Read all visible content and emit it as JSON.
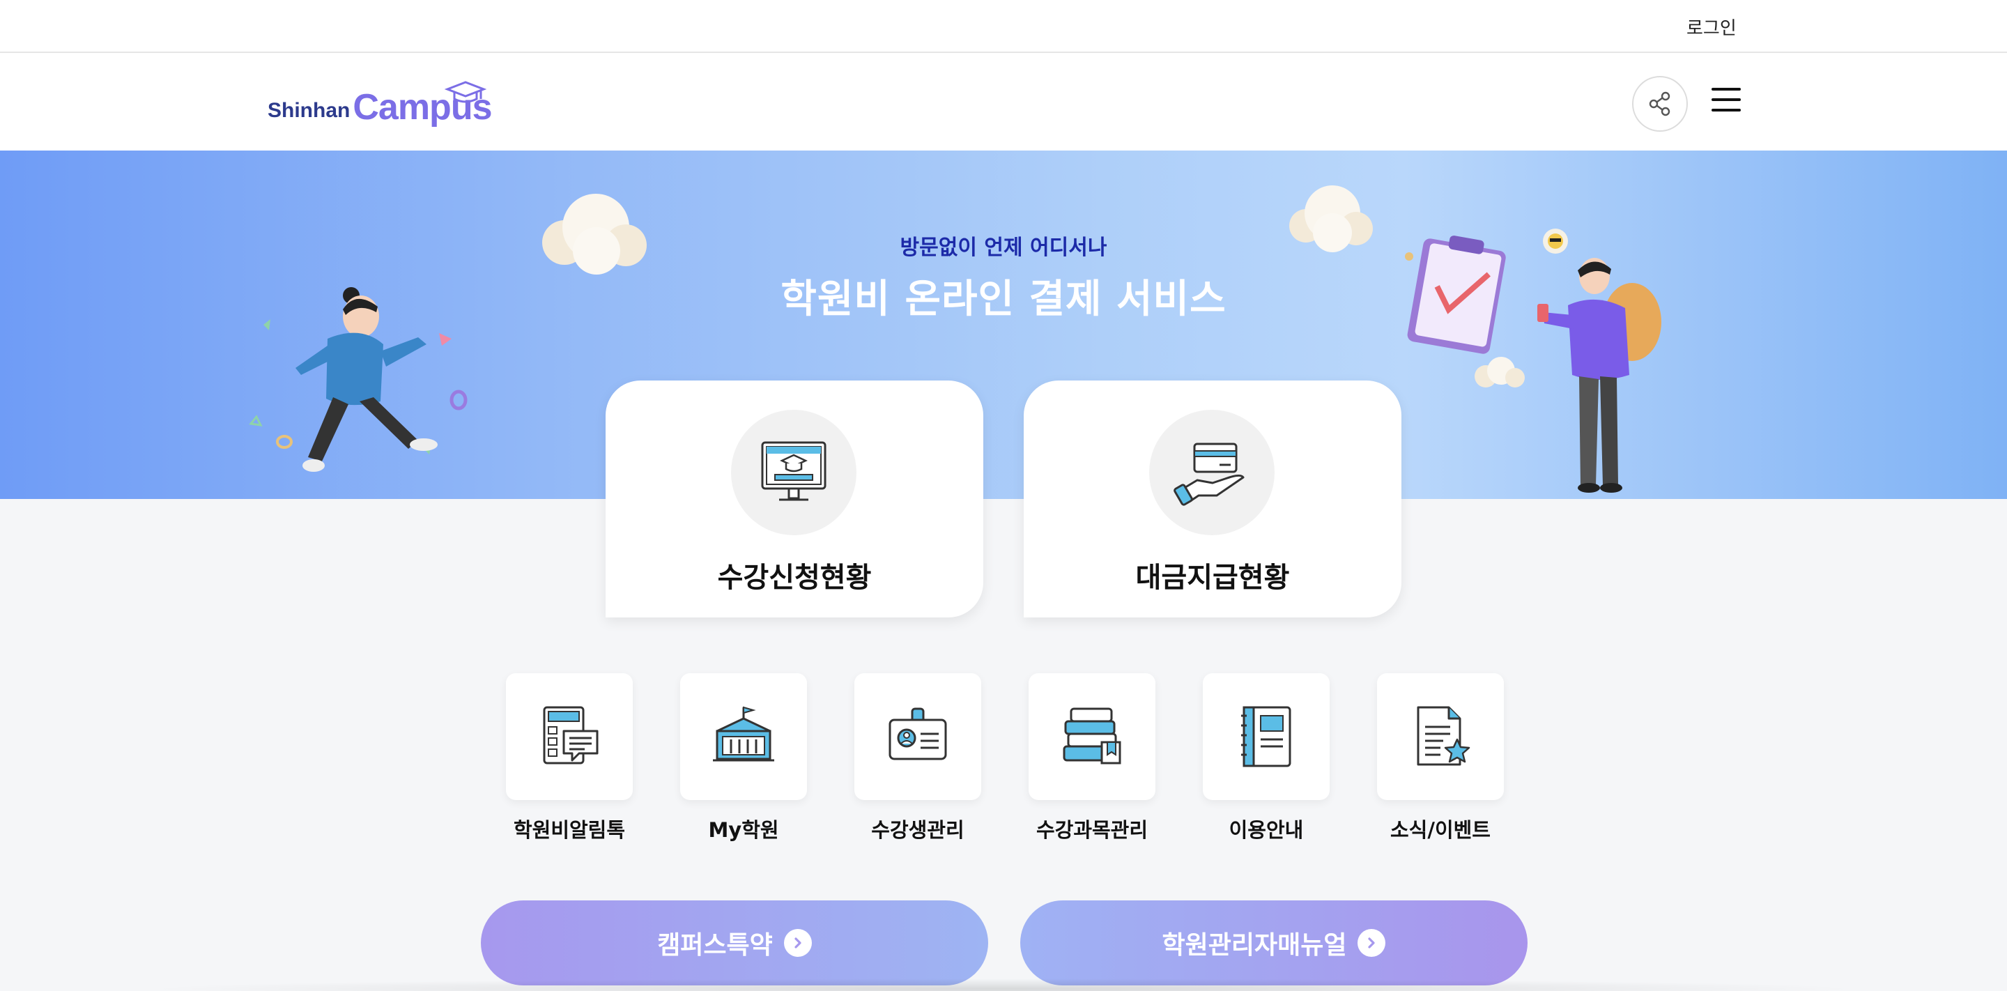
{
  "topbar": {
    "login_label": "로그인"
  },
  "header": {
    "logo_shinhan": "Shinhan",
    "logo_campus": "Campus",
    "share_icon": "share-icon",
    "menu_icon": "hamburger-menu-icon"
  },
  "banner": {
    "subtitle": "방문없이 언제 어디서나",
    "title": "학원비 온라인 결제 서비스"
  },
  "main_cards": [
    {
      "label": "수강신청현황",
      "icon": "monitor-graduation-cap-icon"
    },
    {
      "label": "대금지급현황",
      "icon": "hand-card-icon"
    }
  ],
  "quick_menu": [
    {
      "label": "학원비알림톡",
      "icon": "calculator-message-icon"
    },
    {
      "label": "My학원",
      "icon": "school-building-icon"
    },
    {
      "label": "수강생관리",
      "icon": "id-card-icon"
    },
    {
      "label": "수강과목관리",
      "icon": "book-stack-icon"
    },
    {
      "label": "이용안내",
      "icon": "notebook-icon"
    },
    {
      "label": "소식/이벤트",
      "icon": "document-star-icon"
    }
  ],
  "bottom_buttons": [
    {
      "label": "캠퍼스특약",
      "icon": "chevron-right-circle-icon"
    },
    {
      "label": "학원관리자매뉴얼",
      "icon": "chevron-right-circle-icon"
    }
  ],
  "colors": {
    "accent_purple": "#7b6ee6",
    "logo_navy": "#2c3a8c",
    "banner_blue": "#93b9f7",
    "icon_blue": "#5bbde6"
  }
}
